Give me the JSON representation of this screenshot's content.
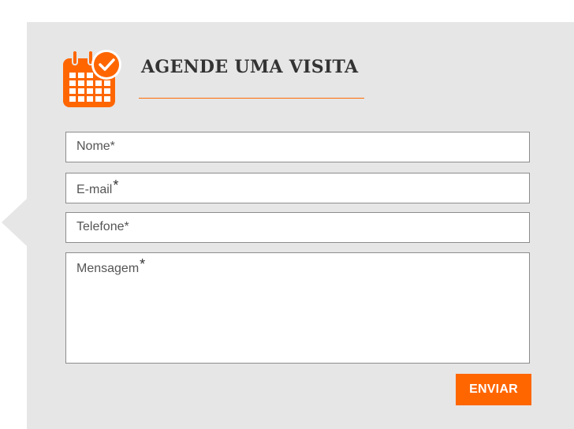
{
  "form": {
    "title": "AGENDE UMA VISITA",
    "fields": {
      "nome": {
        "label": "Nome*"
      },
      "email": {
        "label": "E-mail",
        "required_mark": "*"
      },
      "telefone": {
        "label": "Telefone*"
      },
      "mensagem": {
        "label": "Mensagem",
        "required_mark": "*"
      }
    },
    "submit_label": "ENVIAR"
  },
  "colors": {
    "accent": "#ff6600",
    "panel_background": "#e6e6e6",
    "title_text": "#333333"
  },
  "icons": {
    "header": "calendar-clock-icon"
  }
}
